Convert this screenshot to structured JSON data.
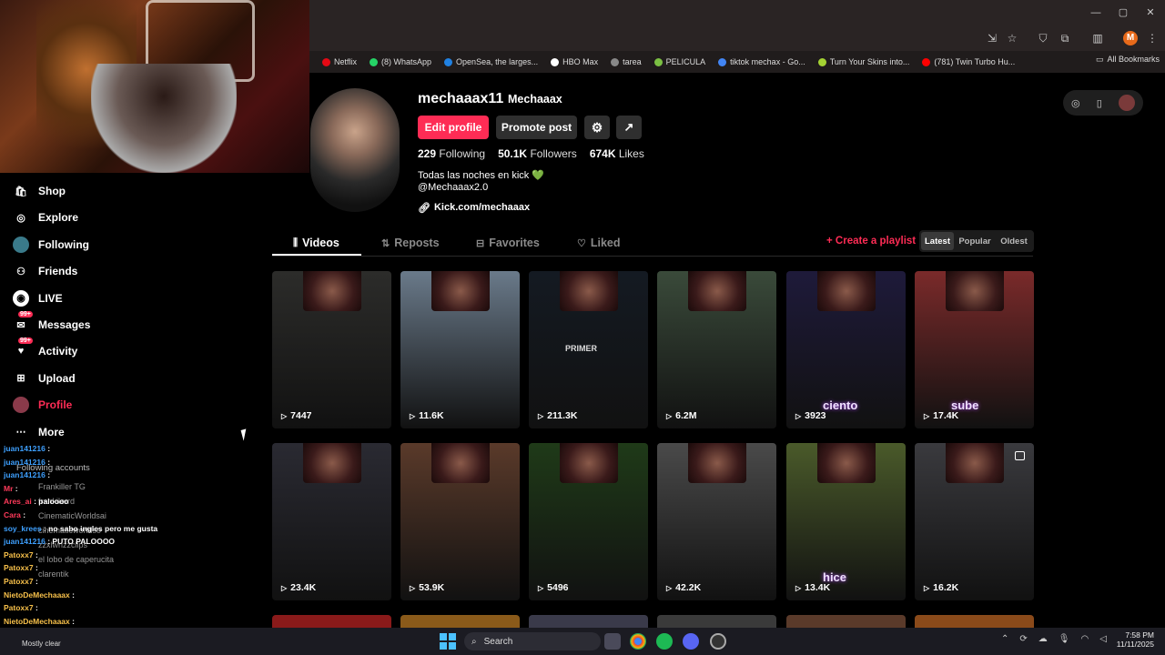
{
  "browser": {
    "bookmarks": [
      {
        "label": "Netflix",
        "color": "#e50914"
      },
      {
        "label": "(8) WhatsApp",
        "color": "#25d366"
      },
      {
        "label": "OpenSea, the larges...",
        "color": "#2081e2"
      },
      {
        "label": "HBO Max",
        "color": "#ffffff"
      },
      {
        "label": "tarea",
        "color": "#888888"
      },
      {
        "label": "PELICULA",
        "color": "#7bc043"
      },
      {
        "label": "tiktok mechax - Go...",
        "color": "#4285f4"
      },
      {
        "label": "Turn Your Skins into...",
        "color": "#a4d233"
      },
      {
        "label": "(781) Twin Turbo Hu...",
        "color": "#ff0000"
      }
    ],
    "all_bookmarks": "All Bookmarks",
    "profile_initial": "M"
  },
  "sidebar": {
    "items": [
      {
        "label": "Shop",
        "icon": "shop-icon",
        "active": false
      },
      {
        "label": "Explore",
        "icon": "compass-icon",
        "active": false
      },
      {
        "label": "Following",
        "icon": "avatar-icon",
        "active": false
      },
      {
        "label": "Friends",
        "icon": "friends-icon",
        "active": false
      },
      {
        "label": "LIVE",
        "icon": "live-icon",
        "active": false
      },
      {
        "label": "Messages",
        "icon": "messages-icon",
        "active": false,
        "badge": "99+"
      },
      {
        "label": "Activity",
        "icon": "activity-icon",
        "active": false,
        "badge": "99+"
      },
      {
        "label": "Upload",
        "icon": "upload-icon",
        "active": false
      },
      {
        "label": "Profile",
        "icon": "profile-icon",
        "active": true
      },
      {
        "label": "More",
        "icon": "more-icon",
        "active": false
      }
    ],
    "following_accounts": "Following accounts"
  },
  "chat": [
    {
      "user": "juan141216",
      "msg": "",
      "color": "#3ea0ff"
    },
    {
      "user": "juan141216",
      "msg": "",
      "color": "#3ea0ff"
    },
    {
      "user": "juan141216",
      "msg": "",
      "color": "#3ea0ff"
    },
    {
      "user": "Mr",
      "msg": "",
      "color": "#ff3a5a"
    },
    {
      "user": "Ares_ai",
      "msg": "paloooo",
      "color": "#ff3a5a"
    },
    {
      "user": "Cara",
      "msg": "",
      "color": "#ff3a5a"
    },
    {
      "user": "soy_krees",
      "msg": "no sabo ingles pero me gusta",
      "color": "#3ea0ff"
    },
    {
      "user": "juan141216",
      "msg": "PUTO PALOOOO",
      "color": "#3ea0ff"
    },
    {
      "user": "Patoxx7",
      "msg": "",
      "color": "#f7c04a"
    },
    {
      "user": "Patoxx7",
      "msg": "",
      "color": "#f7c04a"
    },
    {
      "user": "Patoxx7",
      "msg": "",
      "color": "#f7c04a"
    },
    {
      "user": "NietoDeMechaaax",
      "msg": "",
      "color": "#f7c04a"
    },
    {
      "user": "Patoxx7",
      "msg": "",
      "color": "#f7c04a"
    },
    {
      "user": "NietoDeMechaaax",
      "msg": "",
      "color": "#f7c04a"
    }
  ],
  "following_list": [
    "Frankiller TG",
    "frankilerrd",
    "CinematicWorldsai",
    "cinematicworldso",
    "zzxlwrizzclips",
    "el lobo de caperucita",
    "clarentik"
  ],
  "profile": {
    "username": "mechaaax11",
    "display_name": "Mechaaax",
    "edit_label": "Edit profile",
    "promote_label": "Promote post",
    "following_count": "229",
    "following_label": "Following",
    "followers_count": "50.1K",
    "followers_label": "Followers",
    "likes_count": "674K",
    "likes_label": "Likes",
    "bio_line1": "Todas las noches en kick 💚",
    "bio_line2": "@Mechaaax2.0",
    "link": "Kick.com/mechaaax"
  },
  "tabs": [
    {
      "label": "Videos",
      "icon": "grid-icon",
      "active": true
    },
    {
      "label": "Reposts",
      "icon": "repost-icon",
      "active": false
    },
    {
      "label": "Favorites",
      "icon": "bookmark-icon",
      "active": false
    },
    {
      "label": "Liked",
      "icon": "heart-icon",
      "active": false
    }
  ],
  "create_playlist": "Create a playlist",
  "sort": [
    {
      "label": "Latest",
      "active": true
    },
    {
      "label": "Popular",
      "active": false
    },
    {
      "label": "Oldest",
      "active": false
    }
  ],
  "videos": [
    {
      "views": "7447",
      "caption": "",
      "bg": "#2c2c2a"
    },
    {
      "views": "11.6K",
      "caption": "",
      "bg": "#6a7a8a"
    },
    {
      "views": "211.3K",
      "caption": "PRIMER",
      "bg": "#141a22"
    },
    {
      "views": "6.2M",
      "caption": "",
      "bg": "#3a4a3a"
    },
    {
      "views": "3923",
      "caption": "ciento",
      "bg": "#1e1a3a"
    },
    {
      "views": "17.4K",
      "caption": "sube",
      "bg": "#7a2a2a"
    },
    {
      "views": "23.4K",
      "caption": "",
      "bg": "#2a2a32"
    },
    {
      "views": "53.9K",
      "caption": "",
      "bg": "#5a3a2a"
    },
    {
      "views": "5496",
      "caption": "",
      "bg": "#1f3a18"
    },
    {
      "views": "42.2K",
      "caption": "",
      "bg": "#4a4a4a"
    },
    {
      "views": "13.4K",
      "caption": "hice",
      "bg": "#4a5a2a"
    },
    {
      "views": "16.2K",
      "caption": "",
      "bg": "#3a3a3e"
    }
  ],
  "taskbar": {
    "search_label": "Search",
    "time": "7:58 PM",
    "date": "11/11/2025",
    "weather": "Mostly clear"
  }
}
